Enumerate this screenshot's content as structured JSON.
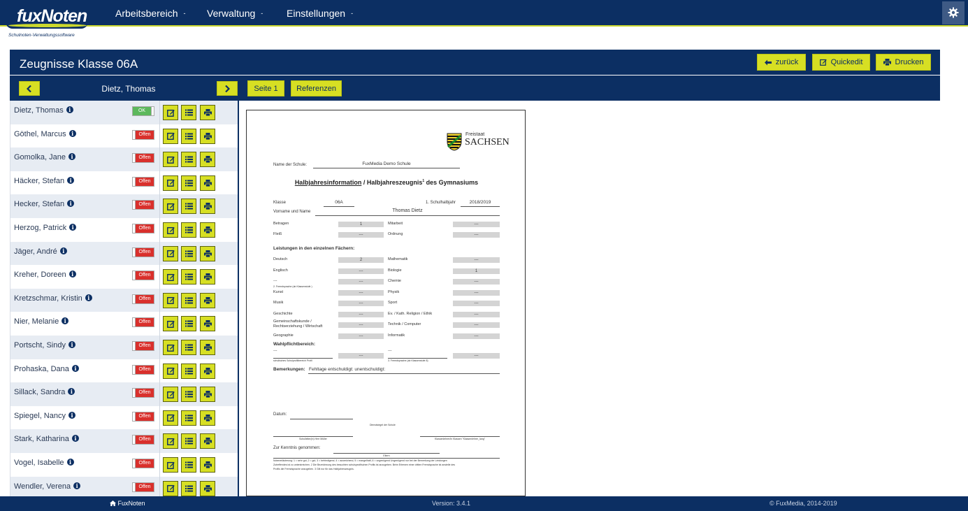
{
  "app": {
    "logo_fux": "fux",
    "logo_noten": "Noten",
    "logo_sub": "Schulnoten-Verwaltungssoftware"
  },
  "nav": {
    "items": [
      {
        "label": "Arbeitsbereich",
        "caret": "-"
      },
      {
        "label": "Verwaltung",
        "caret": "-"
      },
      {
        "label": "Einstellungen",
        "caret": "-"
      }
    ]
  },
  "header": {
    "title": "Zeugnisse Klasse 06A",
    "back_label": "zurück",
    "quickedit_label": "Quickedit",
    "print_label": "Drucken"
  },
  "subbar": {
    "current_student": "Dietz, Thomas",
    "page_button": "Seite 1",
    "references_button": "Referenzen"
  },
  "students": [
    {
      "name": "Dietz, Thomas",
      "status": "OK"
    },
    {
      "name": "Göthel, Marcus",
      "status": "Offen"
    },
    {
      "name": "Gomolka, Jane",
      "status": "Offen"
    },
    {
      "name": "Häcker, Stefan",
      "status": "Offen"
    },
    {
      "name": "Hecker, Stefan",
      "status": "Offen"
    },
    {
      "name": "Herzog, Patrick",
      "status": "Offen"
    },
    {
      "name": "Jäger, André",
      "status": "Offen"
    },
    {
      "name": "Kreher, Doreen",
      "status": "Offen"
    },
    {
      "name": "Kretzschmar, Kristin",
      "status": "Offen"
    },
    {
      "name": "Nier, Melanie",
      "status": "Offen"
    },
    {
      "name": "Portscht, Sindy",
      "status": "Offen"
    },
    {
      "name": "Prohaska, Dana",
      "status": "Offen"
    },
    {
      "name": "Sillack, Sandra",
      "status": "Offen"
    },
    {
      "name": "Spiegel, Nancy",
      "status": "Offen"
    },
    {
      "name": "Stark, Katharina",
      "status": "Offen"
    },
    {
      "name": "Vogel, Isabelle",
      "status": "Offen"
    },
    {
      "name": "Wendler, Verena",
      "status": "Offen"
    }
  ],
  "doc": {
    "emblem_top": "Freistaat",
    "emblem_bottom": "SACHSEN",
    "school_label": "Name der Schule:",
    "school_value": "FuxMedia Demo Schule",
    "heading_part1": "Halbjahresinformation",
    "heading_part2": " / Halbjahreszeugnis",
    "heading_sup": "1",
    "heading_part3": " des Gymnasiums",
    "class_label": "Klasse",
    "class_value": "06A",
    "year_label": "1. Schulhalbjahr",
    "year_value": "2018/2019",
    "name_label": "Vorname und Name",
    "name_value": "Thomas Dietz",
    "conduct": [
      {
        "left": "Betragen",
        "left_val": "1",
        "right": "Mitarbeit",
        "right_val": "---"
      },
      {
        "left": "Fleiß",
        "left_val": "---",
        "right": "Ordnung",
        "right_val": "---"
      }
    ],
    "subjects_heading": "Leistungen in den einzelnen Fächern:",
    "subjects": [
      {
        "left": "Deutsch",
        "left_val": "2",
        "right": "Mathematik",
        "right_val": "---"
      },
      {
        "left": "Englisch",
        "left_val": "---",
        "right": "Biologie",
        "right_val": "1"
      },
      {
        "left": "---",
        "left_val": "---",
        "right": "Chemie",
        "right_val": "---"
      },
      {
        "left": "Kunst",
        "left_val": "---",
        "right": "Physik",
        "right_val": "---"
      },
      {
        "left": "Musik",
        "left_val": "---",
        "right": "Sport",
        "right_val": "---"
      },
      {
        "left": "Geschichte",
        "left_val": "---",
        "right": "Ev. / Kath. Religion / Ethik",
        "right_val": "---"
      },
      {
        "left": "Gemeinschaftskunde / Rechtserziehung / Wirtschaft",
        "left_val": "---",
        "right": "Technik / Computer",
        "right_val": "---"
      },
      {
        "left": "Geographie",
        "left_val": "---",
        "right": "Informatik",
        "right_val": "---"
      }
    ],
    "foreign_lang_note": "2. Fremdsprache (ab Klassenstufe )",
    "elective_heading": "Wahlpflichtbereich:",
    "elective_left": "---",
    "elective_left_val": "---",
    "elective_mid": "---",
    "elective_right_val": "---",
    "elective_note_left": "schulisches Schulprofilbereich Profil",
    "elective_note_right": "3. Fremdsprache (ab Klassenstufe 8)",
    "remarks_label": "Bemerkungen:",
    "remarks_value": "Fehltage entschuldigt: unentschuldigt:",
    "date_label": "Datum:",
    "seal_label": "Dienstsiegel der Schule",
    "principal_label": "Schulleiter(in) Herr Müller",
    "teacher_label": "Klassenlehrer/in Klassen \"Klassenlehrer_lang\"",
    "noted_label": "Zur Kenntnis genommen:",
    "parents_label": "Eltern",
    "footnote": "Notenerläuterung: 1 = sehr gut, 2 = gut, 3 = befriedigend, 4 = ausreichend, 5 = mangelhaft, 6 = ungenügend  Ungenügend nur bei der Bemerkung der Leistungen",
    "footnote2": "Zutreffendes ist zu unterstreichen. 2 Die Bezeichnung des besuchten schulspezifischen Profils ist anzugeben. Beim Erlernen einer dritten Fremdsprache ist anstelle des",
    "footnote3": "Profils die Fremdsprache anzugeben. 3 Gilt nur für das Halbjahreszeugnis."
  },
  "footer": {
    "home_label": "FuxNoten",
    "version": "Version: 3.4.1",
    "copyright": "© FuxMedia, 2014-2019"
  },
  "colors": {
    "navy": "#0c2f63",
    "accent": "#d7df23",
    "offen": "#d9302c",
    "ok": "#5cb85c"
  },
  "icons": {
    "gear": "gear-icon",
    "back": "arrow-left-icon",
    "edit": "edit-icon",
    "list": "list-icon",
    "print": "print-icon",
    "info": "info-icon",
    "home": "home-icon"
  }
}
